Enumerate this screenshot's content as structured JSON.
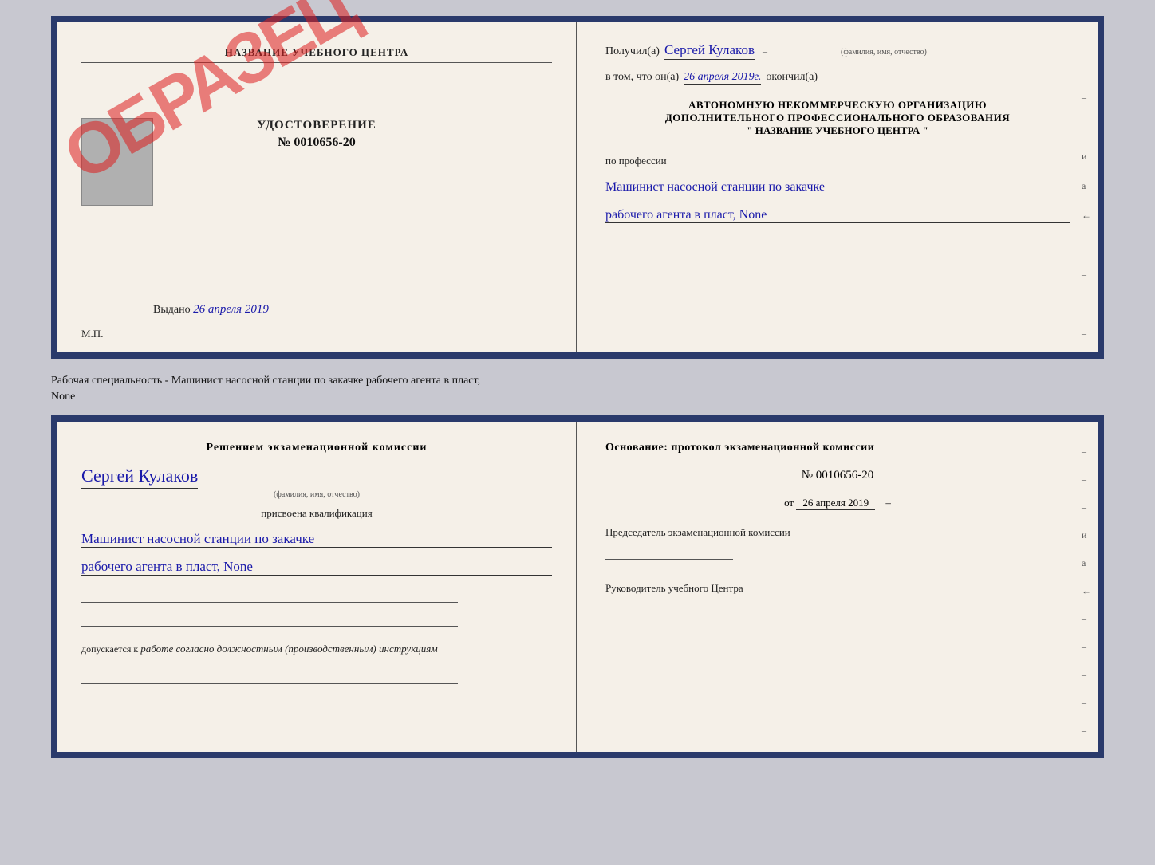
{
  "top_doc": {
    "left": {
      "school_name": "НАЗВАНИЕ УЧЕБНОГО ЦЕНТРА",
      "stamp_text": "ОБРАЗЕЦ",
      "udostoverenie_title": "УДОСТОВЕРЕНИЕ",
      "udostoverenie_num": "№ 0010656-20",
      "vydano_label": "Выдано",
      "vydano_date": "26 апреля 2019",
      "mp_label": "М.П."
    },
    "right": {
      "poluchil_label": "Получил(а)",
      "poluchil_name": "Сергей Кулаков",
      "fio_hint": "(фамилия, имя, отчество)",
      "vtom_label": "в том, что он(а)",
      "vtom_date": "26 апреля 2019г.",
      "okonchil_label": "окончил(а)",
      "org_line1": "АВТОНОМНУЮ НЕКОММЕРЧЕСКУЮ ОРГАНИЗАЦИЮ",
      "org_line2": "ДОПОЛНИТЕЛЬНОГО ПРОФЕССИОНАЛЬНОГО ОБРАЗОВАНИЯ",
      "org_line3": "\"  НАЗВАНИЕ УЧЕБНОГО ЦЕНТРА  \"",
      "po_professii": "по профессии",
      "profession_line1": "Машинист насосной станции по закачке",
      "profession_line2": "рабочего агента в пласт, None",
      "dashes": [
        "-",
        "-",
        "-",
        "и",
        "а",
        "←",
        "-",
        "-",
        "-",
        "-",
        "-"
      ]
    }
  },
  "middle": {
    "text_line1": "Рабочая специальность - Машинист насосной станции по закачке рабочего агента в пласт,",
    "text_line2": "None"
  },
  "bottom_doc": {
    "left": {
      "resheniem_text": "Решением  экзаменационной  комиссии",
      "name": "Сергей Кулаков",
      "fio_hint": "(фамилия, имя, отчество)",
      "prisvoena": "присвоена квалификация",
      "qualification_line1": "Машинист насосной станции по закачке",
      "qualification_line2": "рабочего агента в пласт, None",
      "dopuskaetsya_label": "допускается к",
      "dopusk_text": "работе согласно должностным (производственным) инструкциям"
    },
    "right": {
      "osnovanie_text": "Основание: протокол экзаменационной  комиссии",
      "protokol_num": "№ 0010656-20",
      "ot_label": "от",
      "ot_date": "26 апреля 2019",
      "predsedatel_label": "Председатель экзаменационной комиссии",
      "rukovoditel_label": "Руководитель учебного Центра",
      "dashes": [
        "-",
        "-",
        "-",
        "и",
        "а",
        "←",
        "-",
        "-",
        "-",
        "-",
        "-"
      ]
    }
  }
}
